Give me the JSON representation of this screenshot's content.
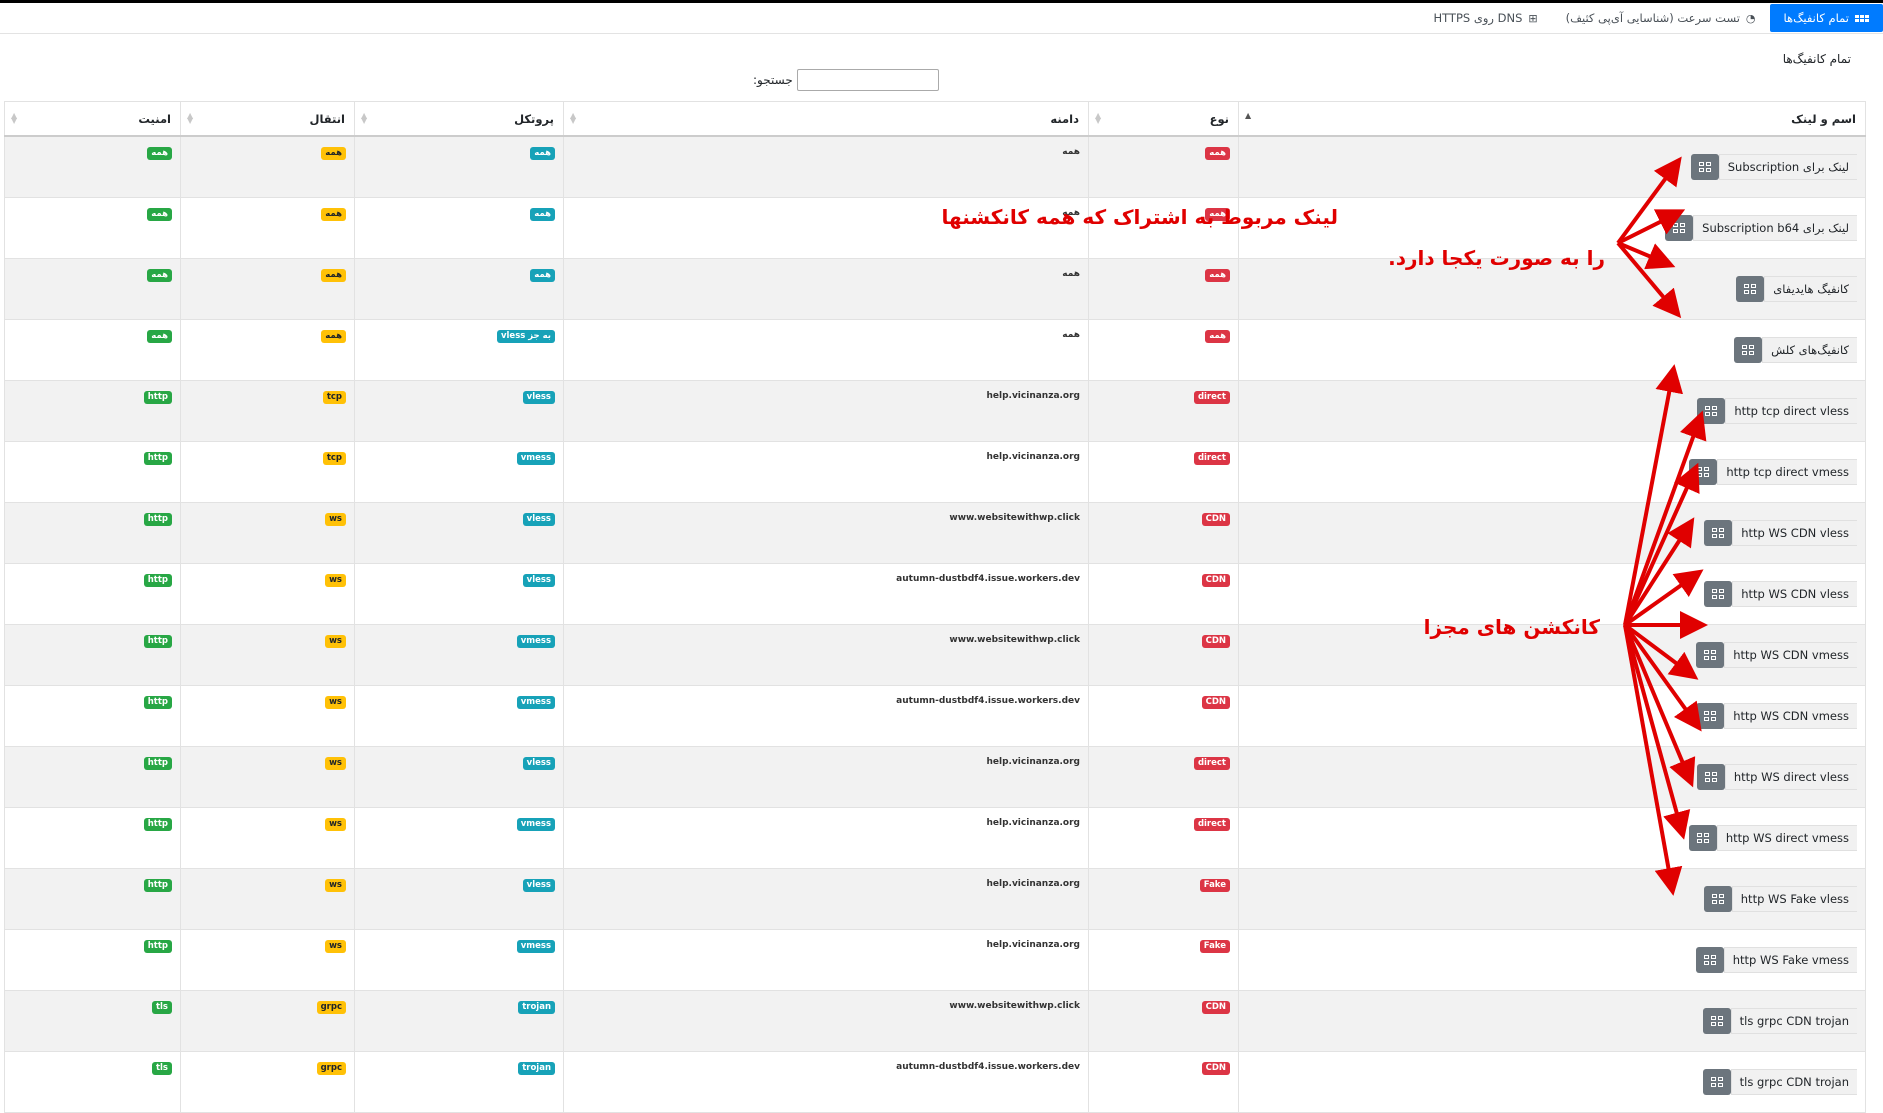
{
  "nav": {
    "tabs": [
      {
        "label": "تمام کانفیگ‌ها",
        "icon": "grid-icon",
        "active": true
      },
      {
        "label": "تست سرعت (شناسایی آی‌پی کثیف)",
        "icon": "speedometer-icon",
        "active": false
      },
      {
        "label": "DNS روی HTTPS",
        "icon": "sitemap-icon",
        "active": false
      }
    ]
  },
  "page_title": "تمام کانفیگ‌ها",
  "search": {
    "label": "جستجو:",
    "value": ""
  },
  "table": {
    "headers": [
      "اسم و لینک",
      "نوع",
      "دامنه",
      "پروتکل",
      "انتقال",
      "امنیت"
    ],
    "rows": [
      {
        "name": "لینک برای Subscription",
        "type": "همه",
        "domain": "همه",
        "protocol": "همه",
        "transport": "همه",
        "security": "همه"
      },
      {
        "name": "لینک برای Subscription b64",
        "type": "همه",
        "domain": "همه",
        "protocol": "همه",
        "transport": "همه",
        "security": "همه"
      },
      {
        "name": "کانفیگ هایدیفای",
        "type": "همه",
        "domain": "همه",
        "protocol": "همه",
        "transport": "همه",
        "security": "همه"
      },
      {
        "name": "کانفیگ‌های کلش",
        "type": "همه",
        "domain": "همه",
        "protocol": "به جز vless",
        "transport": "همه",
        "security": "همه"
      },
      {
        "name": "http tcp direct vless",
        "type": "direct",
        "domain": "help.vicinanza.org",
        "protocol": "vless",
        "transport": "tcp",
        "security": "http"
      },
      {
        "name": "http tcp direct vmess",
        "type": "direct",
        "domain": "help.vicinanza.org",
        "protocol": "vmess",
        "transport": "tcp",
        "security": "http"
      },
      {
        "name": "http WS CDN vless",
        "type": "CDN",
        "domain": "www.websitewithwp.click",
        "protocol": "vless",
        "transport": "ws",
        "security": "http"
      },
      {
        "name": "http WS CDN vless",
        "type": "CDN",
        "domain": "autumn-dustbdf4.issue.workers.dev",
        "protocol": "vless",
        "transport": "ws",
        "security": "http"
      },
      {
        "name": "http WS CDN vmess",
        "type": "CDN",
        "domain": "www.websitewithwp.click",
        "protocol": "vmess",
        "transport": "ws",
        "security": "http"
      },
      {
        "name": "http WS CDN vmess",
        "type": "CDN",
        "domain": "autumn-dustbdf4.issue.workers.dev",
        "protocol": "vmess",
        "transport": "ws",
        "security": "http"
      },
      {
        "name": "http WS direct vless",
        "type": "direct",
        "domain": "help.vicinanza.org",
        "protocol": "vless",
        "transport": "ws",
        "security": "http"
      },
      {
        "name": "http WS direct vmess",
        "type": "direct",
        "domain": "help.vicinanza.org",
        "protocol": "vmess",
        "transport": "ws",
        "security": "http"
      },
      {
        "name": "http WS Fake vless",
        "type": "Fake",
        "domain": "help.vicinanza.org",
        "protocol": "vless",
        "transport": "ws",
        "security": "http"
      },
      {
        "name": "http WS Fake vmess",
        "type": "Fake",
        "domain": "help.vicinanza.org",
        "protocol": "vmess",
        "transport": "ws",
        "security": "http"
      },
      {
        "name": "tls grpc CDN trojan",
        "type": "CDN",
        "domain": "www.websitewithwp.click",
        "protocol": "trojan",
        "transport": "grpc",
        "security": "tls"
      },
      {
        "name": "tls grpc CDN trojan",
        "type": "CDN",
        "domain": "autumn-dustbdf4.issue.workers.dev",
        "protocol": "trojan",
        "transport": "grpc",
        "security": "tls"
      }
    ]
  },
  "annotations": {
    "subscription_note_line1": "لینک مربوط به اشتراک که همه کانکشنها",
    "subscription_note_line2": "را به صورت یکجا دارد.",
    "individual_note": "کانکشن های مجزا",
    "color": "#e00000"
  },
  "colors": {
    "primary": "#007bff",
    "badge_type": "#dc3545",
    "badge_protocol": "#17a2b8",
    "badge_transport": "#ffc107",
    "badge_security": "#28a745",
    "config_button": "#6c757d"
  }
}
